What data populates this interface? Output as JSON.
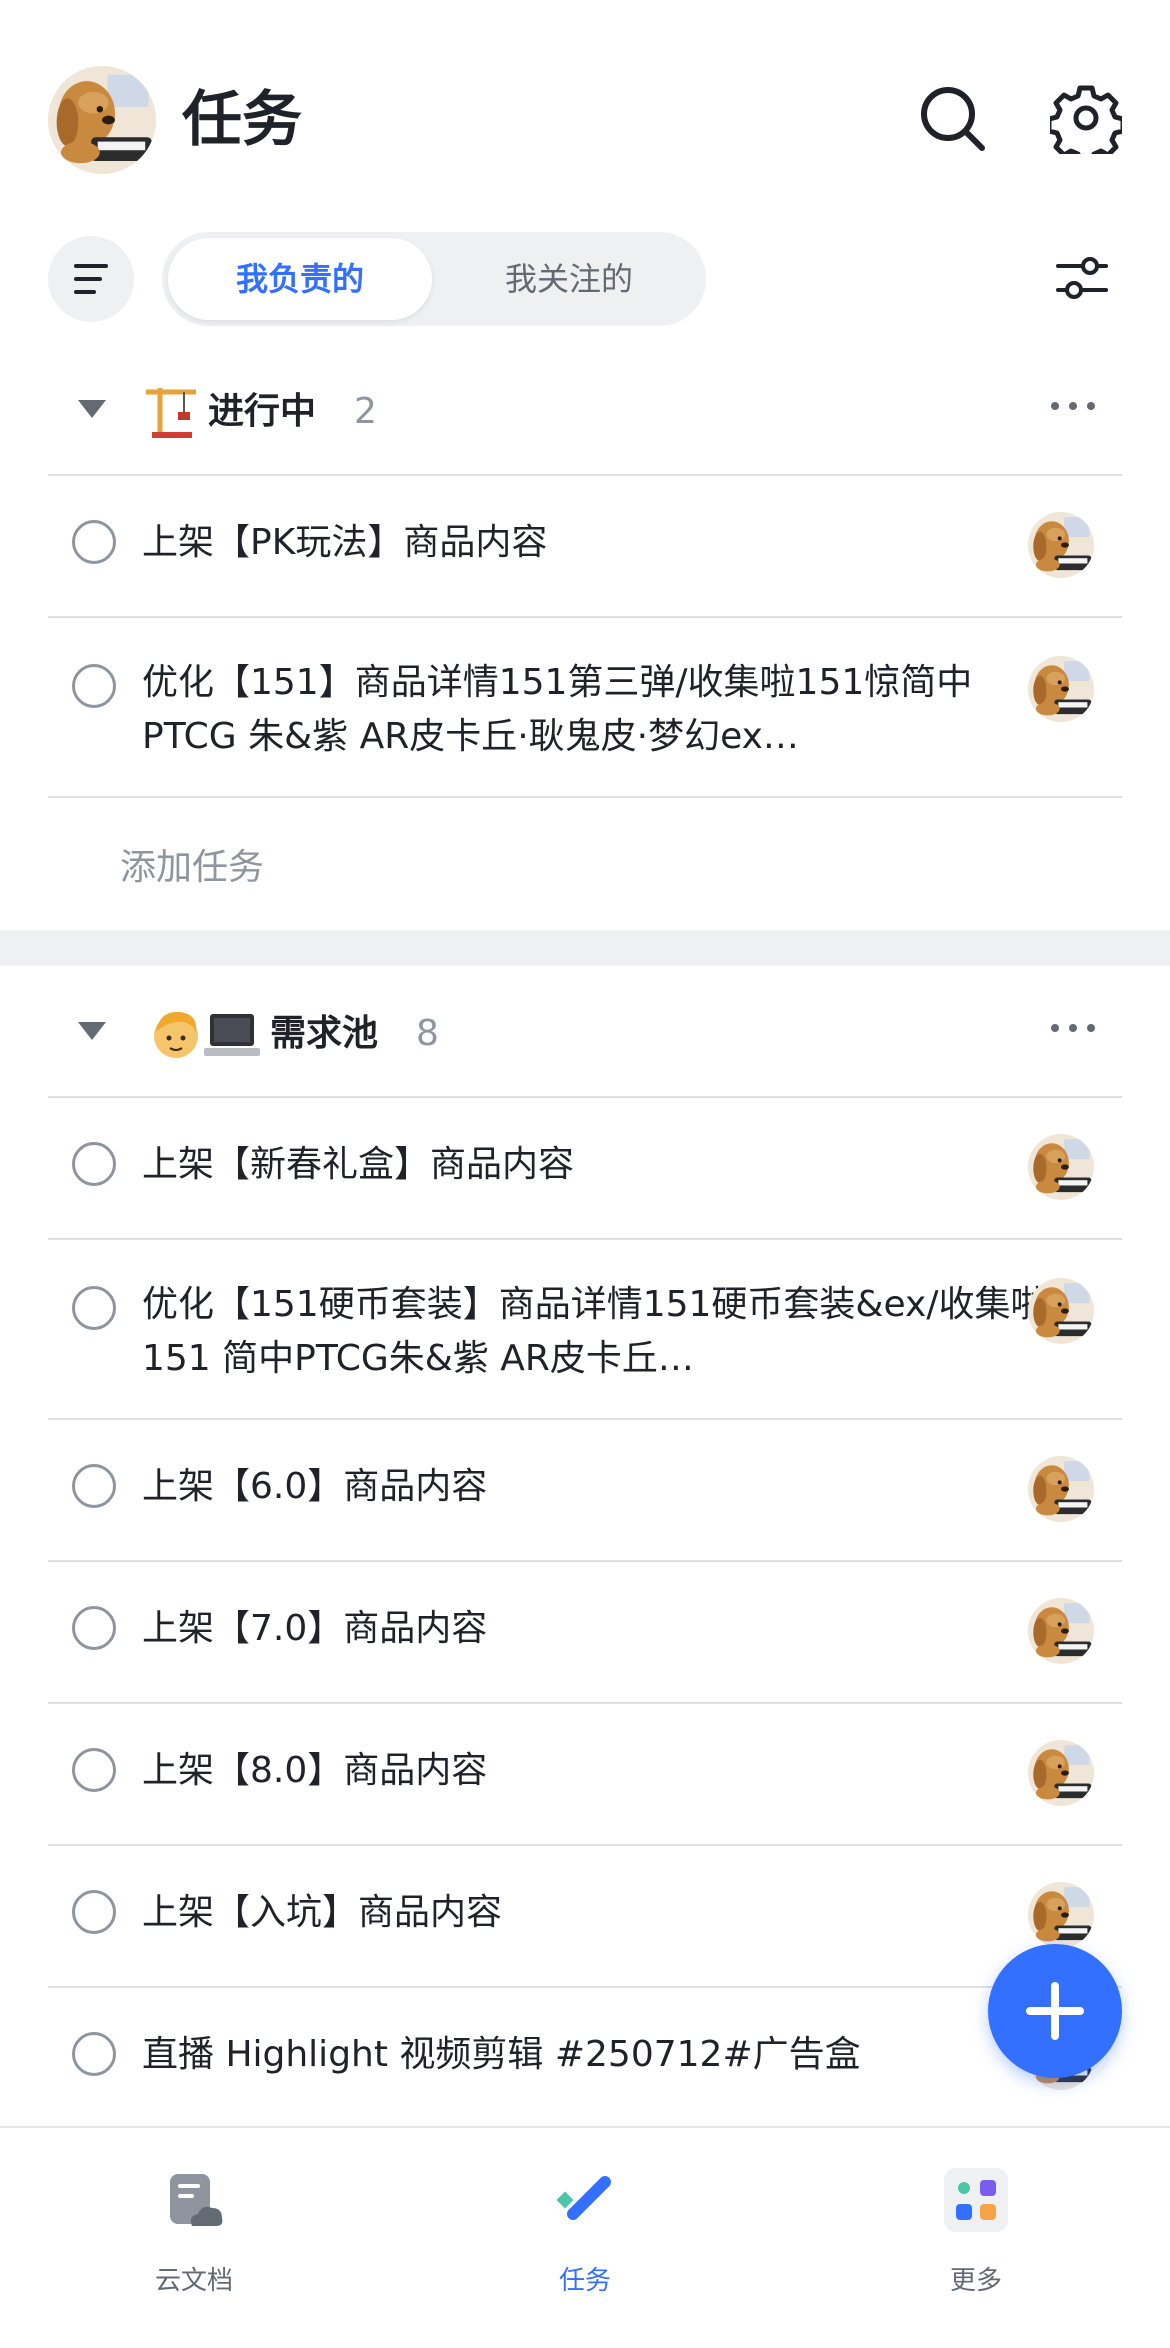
{
  "header": {
    "title": "任务",
    "avatar_icon": "user-avatar-dog",
    "search_icon": "search-icon",
    "settings_icon": "gear-icon"
  },
  "toolbar": {
    "menu_icon": "menu-icon",
    "segments": [
      {
        "label": "我负责的",
        "active": true
      },
      {
        "label": "我关注的",
        "active": false
      }
    ],
    "filter_icon": "filter-sliders-icon"
  },
  "groups": [
    {
      "emoji": "🏗️",
      "title": "进行中",
      "count": "2",
      "tasks": [
        {
          "title": "上架【PK玩法】商品内容"
        },
        {
          "title": "优化【151】商品详情151第三弹/收集啦151惊简中 PTCG 朱&紫 AR皮卡丘·耿鬼皮·梦幻ex…"
        }
      ],
      "add_label": "添加任务"
    },
    {
      "emoji": "👦💻",
      "title": "需求池",
      "count": "8",
      "tasks": [
        {
          "title": "上架【新春礼盒】商品内容"
        },
        {
          "title": "优化【151硬币套装】商品详情151硬币套装&ex/收集啦151 简中PTCG朱&紫 AR皮卡丘…"
        },
        {
          "title": "上架【6.0】商品内容"
        },
        {
          "title": "上架【7.0】商品内容"
        },
        {
          "title": "上架【8.0】商品内容"
        },
        {
          "title": "上架【入坑】商品内容"
        },
        {
          "title": "直播 Highlight 视频剪辑 #250712#广告盒"
        }
      ]
    }
  ],
  "fab_icon": "plus-icon",
  "tabbar": {
    "tabs": [
      {
        "label": "云文档",
        "icon": "cloud-docs-icon",
        "active": false
      },
      {
        "label": "任务",
        "icon": "task-check-icon",
        "active": true
      },
      {
        "label": "更多",
        "icon": "more-apps-icon",
        "active": false
      }
    ]
  },
  "colors": {
    "accent": "#3370ff",
    "text_primary": "#1f2329",
    "text_secondary": "#8f959e",
    "divider": "#dee0e3",
    "band": "#eff0f1"
  }
}
